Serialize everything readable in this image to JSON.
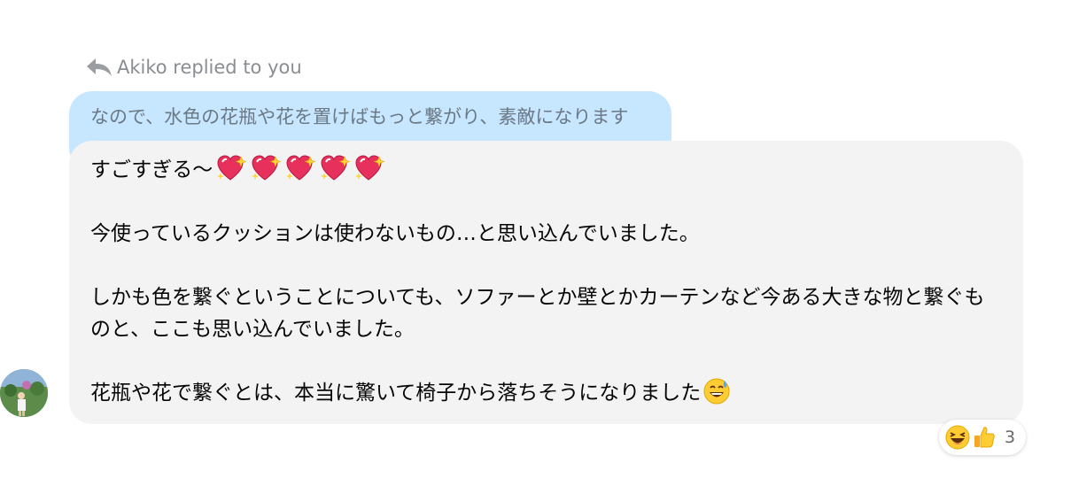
{
  "reply_header": {
    "text": "Akiko replied to you",
    "icon": "reply-arrow-icon"
  },
  "quoted_message": {
    "text": "なので、水色の花瓶や花を置けばもっと繋がり、素敵になります"
  },
  "message": {
    "line1": "すごすぎる〜",
    "line1_emoji": "sparkling-heart-icon",
    "line1_emoji_count": 5,
    "line2": "今使っているクッションは使わないもの…と思い込んでいました。",
    "line3": "しかも色を繋ぐということについても、ソファーとか壁とかカーテンなど今ある大きな物と繋ぐも",
    "line4": "のと、ここも思い込んでいました。",
    "line5": "花瓶や花で繋ぐとは、本当に驚いて椅子から落ちそうになりました",
    "line5_emoji": "grinning-sweat-icon"
  },
  "reactions": {
    "icons": [
      "laughing-face-icon",
      "thumbs-up-icon"
    ],
    "count": "3"
  },
  "colors": {
    "quoted_bubble": "#c7e6ff",
    "main_bubble": "#f3f3f3",
    "meta_text": "#8a8d91",
    "heart": "#e8305c",
    "like_blue": "#1877f2"
  }
}
